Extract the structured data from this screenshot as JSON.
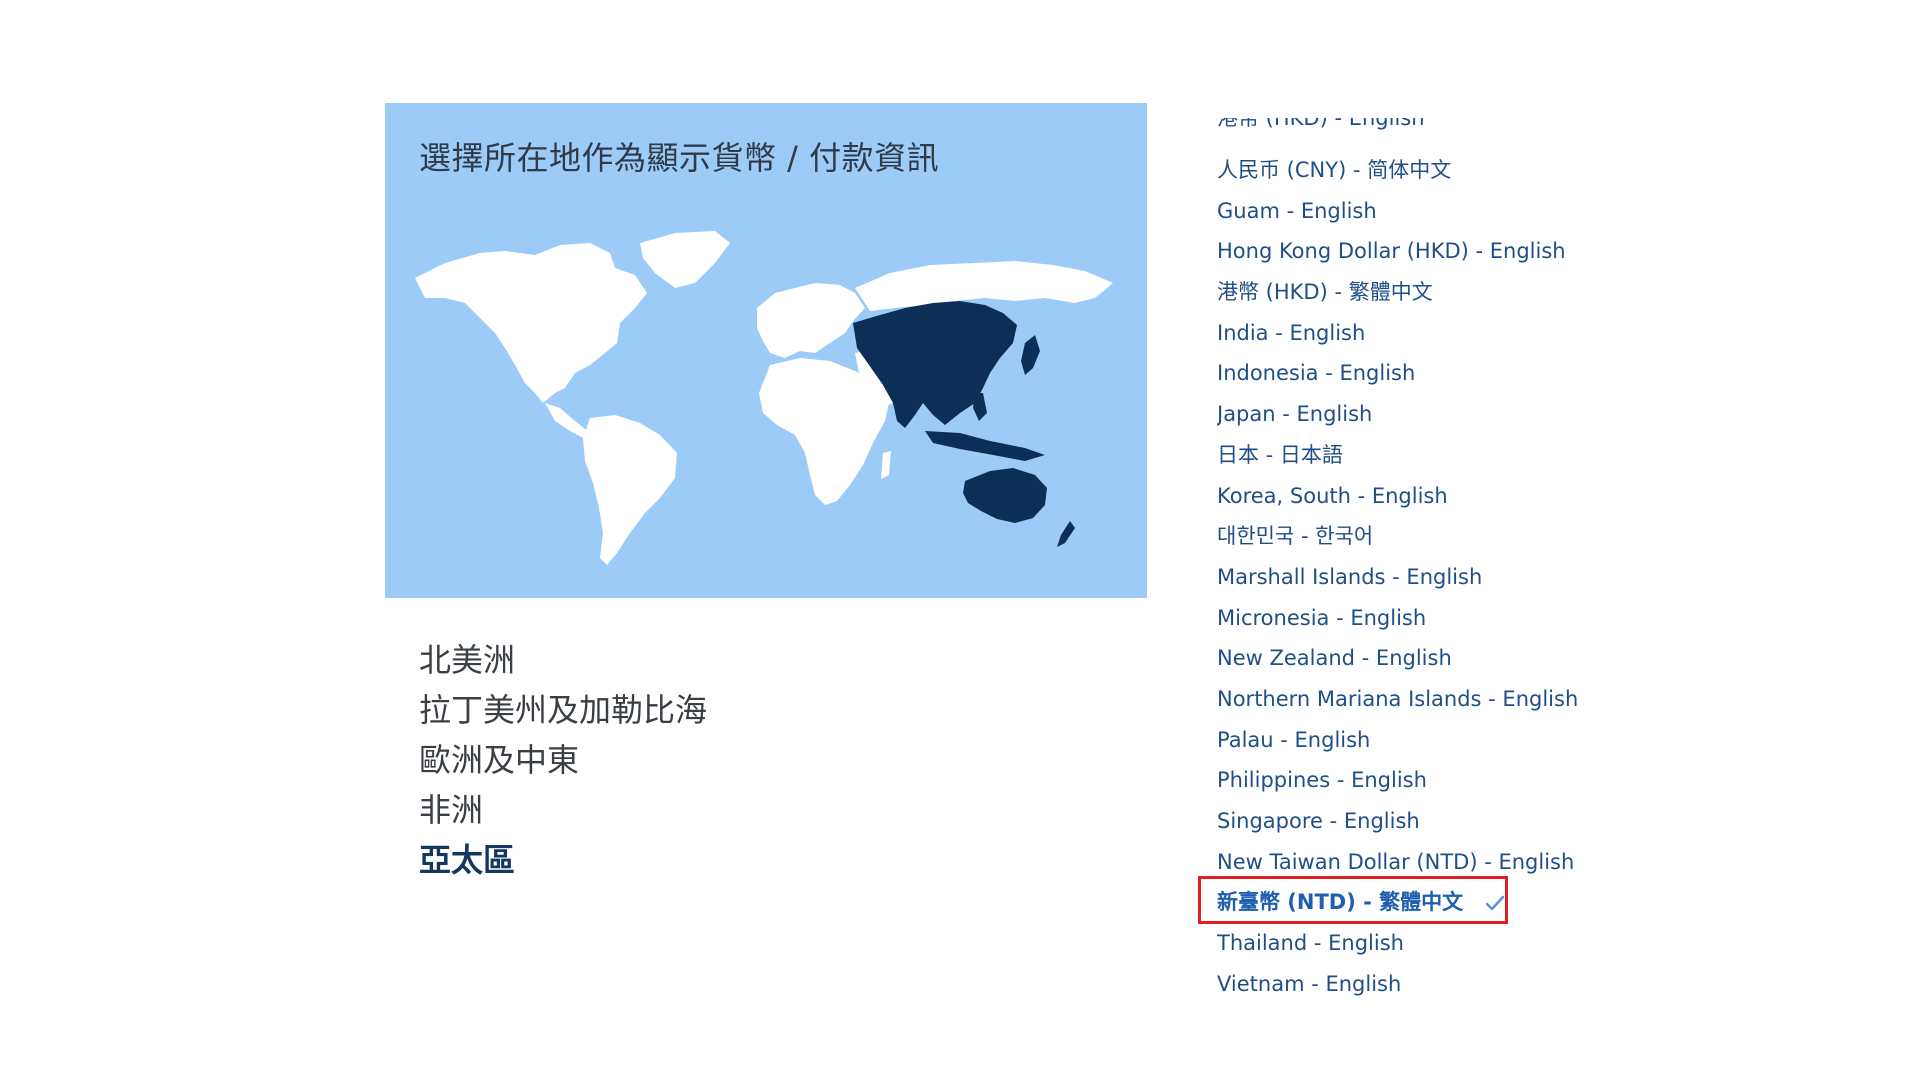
{
  "map": {
    "title": "選擇所在地作為顯示貨幣 / 付款資訊",
    "highlighted_region": "亞太區"
  },
  "regions": [
    {
      "label": "北美洲",
      "active": false
    },
    {
      "label": "拉丁美州及加勒比海",
      "active": false
    },
    {
      "label": "歐洲及中東",
      "active": false
    },
    {
      "label": "非洲",
      "active": false
    },
    {
      "label": "亞太區",
      "active": true
    }
  ],
  "locales": {
    "clipped_top_label": "港幣 (HKD) - English",
    "items": [
      {
        "label": "人民币 (CNY) - 简体中文"
      },
      {
        "label": "Guam - English"
      },
      {
        "label": "Hong Kong Dollar (HKD) - English"
      },
      {
        "label": "港幣 (HKD) - 繁體中文"
      },
      {
        "label": "India - English"
      },
      {
        "label": "Indonesia - English"
      },
      {
        "label": "Japan - English"
      },
      {
        "label": "日本 - 日本語"
      },
      {
        "label": "Korea, South - English"
      },
      {
        "label": "대한민국 - 한국어"
      },
      {
        "label": "Marshall Islands - English"
      },
      {
        "label": "Micronesia - English"
      },
      {
        "label": "New Zealand - English"
      },
      {
        "label": "Northern Mariana Islands - English"
      },
      {
        "label": "Palau - English"
      },
      {
        "label": "Philippines - English"
      },
      {
        "label": "Singapore - English"
      },
      {
        "label": "New Taiwan Dollar (NTD) - English"
      },
      {
        "label": "新臺幣 (NTD) - 繁體中文",
        "selected": true,
        "icon": "checkmark-icon"
      },
      {
        "label": "Thailand - English"
      },
      {
        "label": "Vietnam - English"
      }
    ]
  },
  "colors": {
    "map_background": "#9ccbf8",
    "land": "#ffffff",
    "highlighted_land": "#0b2f56",
    "link": "#1f4f86",
    "selected": "#1f5fb0",
    "highlight_border": "#e02020"
  }
}
